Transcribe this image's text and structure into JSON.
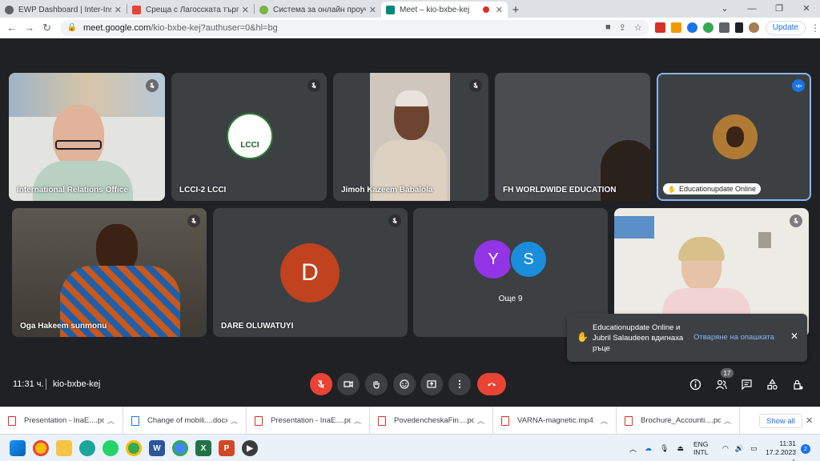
{
  "browser": {
    "tabs": [
      {
        "label": "EWP Dashboard | Inter-Institution",
        "favicon_color": "#5f6368",
        "active": false
      },
      {
        "label": "Среща с Лагосската търговско п",
        "favicon_color": "#ea4335",
        "active": false
      },
      {
        "label": "Система за онлайн проучвания",
        "favicon_color": "#7cb342",
        "active": false
      },
      {
        "label": "Meet – kio-bxbe-kej",
        "favicon_color": "#00897b",
        "active": true
      }
    ],
    "new_tab": "+",
    "url_host": "meet.google.com",
    "url_path": "/kio-bxbe-kej?authuser=0&hl=bg",
    "update_label": "Update"
  },
  "tiles": [
    {
      "name": "International Relations Office",
      "muted": true
    },
    {
      "name": "LCCI-2 LCCI",
      "muted": true,
      "logo_text": "LCCI"
    },
    {
      "name": "Jimoh Kazeem Babalola",
      "muted": true
    },
    {
      "name": "FH WORLDWIDE EDUCATION",
      "muted": false
    },
    {
      "name": "Educationupdate Online",
      "muted": false,
      "speaking": true
    },
    {
      "name": "Oga Hakeem sunmonu",
      "muted": true
    },
    {
      "name": "DARE OLUWATUYI",
      "muted": true,
      "initial": "D",
      "avatar_color": "#c1421f"
    },
    {
      "name": "Още 9",
      "muted": false,
      "initials": [
        "Y",
        "S"
      ],
      "avatar_colors": [
        "#9334e6",
        "#1a8ddb"
      ]
    },
    {
      "name": "",
      "muted": true
    }
  ],
  "controls": {
    "time": "11:31 ч.",
    "meeting_code": "kio-bxbe-kej",
    "participants_count": "17"
  },
  "toast": {
    "message": "Educationupdate Online и Jubril Salaudeen вдигнаха ръце",
    "action": "Отваряне на опашката"
  },
  "downloads": {
    "items": [
      {
        "name": "Presentation - InaE....pdf",
        "color": "#d93025"
      },
      {
        "name": "Change of mobili....docx",
        "color": "#1a73e8"
      },
      {
        "name": "Presentation - InaE....pdf",
        "color": "#d93025"
      },
      {
        "name": "PovedencheskaFin....pdf",
        "color": "#d93025"
      },
      {
        "name": "VARNA-magnetic.mp4",
        "color": "#d93025"
      },
      {
        "name": "Brochure_Accounti....pdf",
        "color": "#d93025"
      }
    ],
    "show_all": "Show all"
  },
  "taskbar": {
    "lang_line1": "ENG",
    "lang_line2": "INTL",
    "clock_time": "11:31",
    "clock_date": "17.2.2023 г.",
    "notifications": "2"
  }
}
